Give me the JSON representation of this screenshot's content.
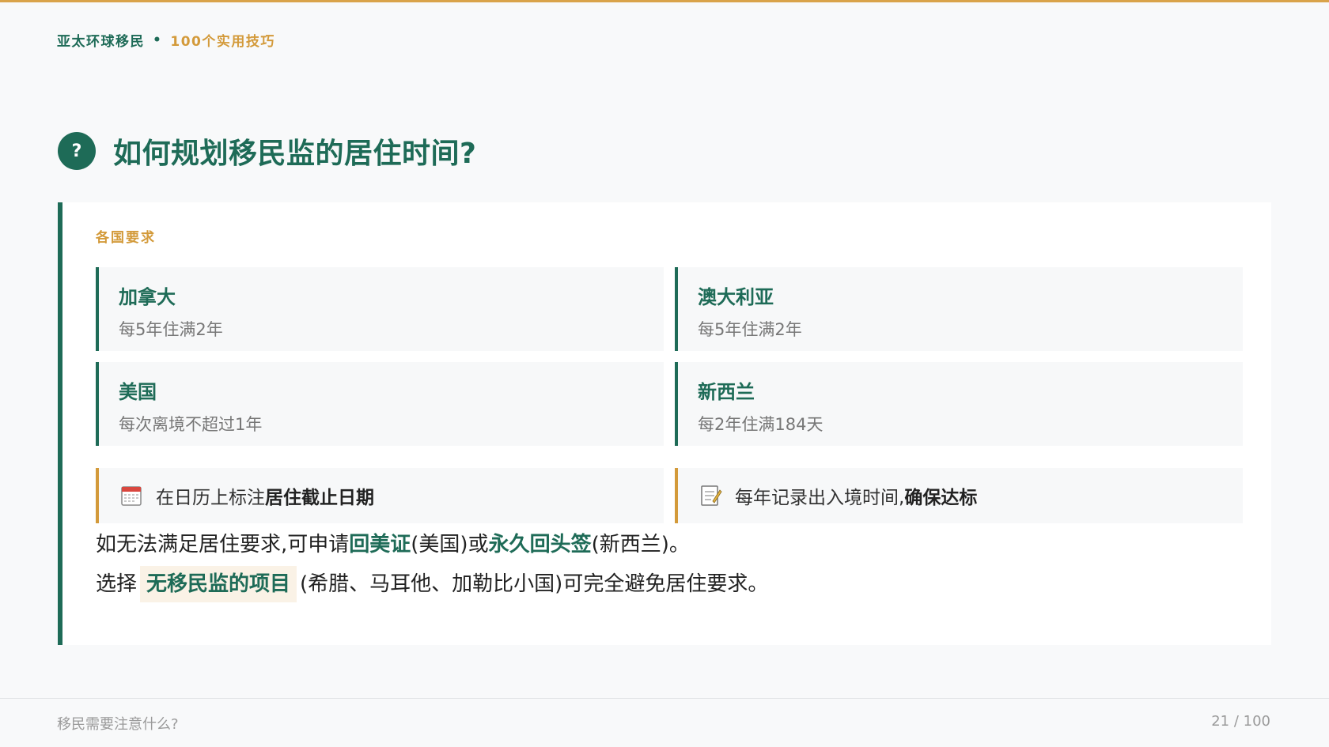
{
  "header": {
    "org": "亚太环球移民",
    "separator": "•",
    "series": "100个实用技巧"
  },
  "question": {
    "badge": "?",
    "title": "如何规划移民监的居住时间?"
  },
  "card": {
    "label": "各国要求",
    "countries": [
      {
        "name": "加拿大",
        "rule": "每5年住满2年"
      },
      {
        "name": "澳大利亚",
        "rule": "每5年住满2年"
      },
      {
        "name": "美国",
        "rule": "每次离境不超过1年"
      },
      {
        "name": "新西兰",
        "rule": "每2年住满184天"
      }
    ],
    "tips": [
      {
        "icon": "calendar-icon",
        "text": "在日历上标注",
        "bold": "居住截止日期"
      },
      {
        "icon": "memo-icon",
        "text": "每年记录出入境时间,",
        "bold": "确保达标"
      }
    ],
    "notes": {
      "line1_a": "如无法满足居住要求,可申请",
      "line1_hl1": "回美证",
      "line1_b": "(美国)或",
      "line1_hl2": "永久回头签",
      "line1_c": "(新西兰)。",
      "line2_a": "选择",
      "line2_hl": "无移民监的项目",
      "line2_b": "(希腊、马耳他、加勒比小国)可完全避免居住要求。"
    }
  },
  "footer": {
    "topic": "移民需要注意什么?",
    "page": "21 / 100"
  },
  "colors": {
    "primary": "#1e6b57",
    "accent": "#d39a3a"
  }
}
